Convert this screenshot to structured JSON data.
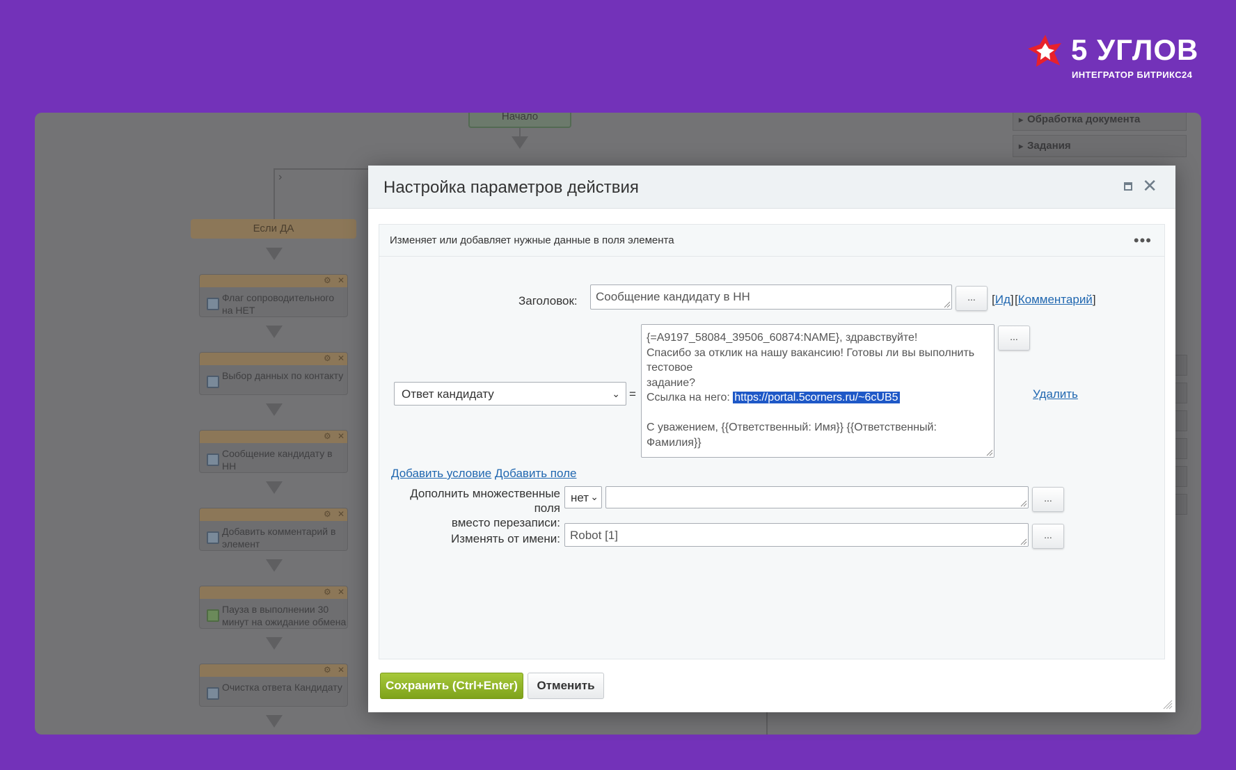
{
  "brand": {
    "title": "5 УГЛОВ",
    "subtitle": "ИНТЕГРАТОР БИТРИКС24",
    "accent": "#e8212b"
  },
  "designer": {
    "start_label": "Начало",
    "if_yes_label": "Если ДА",
    "blocks": [
      {
        "label": "Флаг сопроводительного на НЕТ"
      },
      {
        "label": "Выбор данных по контакту"
      },
      {
        "label": "Сообщение кандидату в НН"
      },
      {
        "label": "Добавить комментарий в элемент"
      },
      {
        "label": "Пауза в выполнении 30 минут на ожидание обмена"
      },
      {
        "label": "Очистка ответа Кандидату"
      }
    ],
    "right_panel": [
      "Обработка документа",
      "Задания"
    ]
  },
  "dialog": {
    "title": "Настройка параметров действия",
    "description": "Изменяет или добавляет нужные данные в поля элемента",
    "title_field_label": "Заголовок:",
    "title_field_value": "Сообщение кандидату в НН",
    "dots": "...",
    "id_link": "Ид",
    "comment_link": "Комментарий",
    "field_select_value": "Ответ кандидату",
    "equals": "=",
    "message_lines": [
      "{=A9197_58084_39506_60874:NAME}, здравствуйте!",
      "Спасибо за отклик на нашу вакансию! Готовы ли вы выполнить тестовое",
      "задание?",
      "Ссылка на него: ",
      "",
      "С уважением, {{Ответственный: Имя}} {{Ответственный: Фамилия}}"
    ],
    "message_link": "https://portal.5corners.ru/~6cUB5",
    "delete_link": "Удалить",
    "add_condition": "Добавить условие",
    "add_field": "Добавить поле",
    "append_label_1": "Дополнить множественные поля",
    "append_label_2": "вместо перезаписи:",
    "append_select_value": "нет",
    "append_value": "",
    "modify_by_label": "Изменять от имени:",
    "modify_by_value": "Robot [1]",
    "save_button": "Сохранить (Ctrl+Enter)",
    "cancel_button": "Отменить"
  }
}
